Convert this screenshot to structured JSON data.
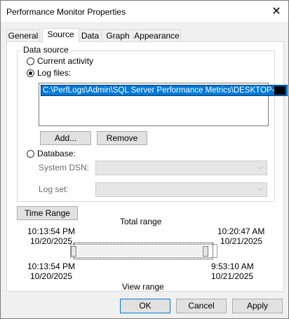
{
  "window": {
    "title": "Performance Monitor Properties",
    "close_glyph": "✕"
  },
  "tabs": [
    {
      "label": "General",
      "active": false
    },
    {
      "label": "Source",
      "active": true
    },
    {
      "label": "Data",
      "active": false
    },
    {
      "label": "Graph",
      "active": false
    },
    {
      "label": "Appearance",
      "active": false
    }
  ],
  "data_source": {
    "group_label": "Data source",
    "current_activity_label": "Current activity",
    "log_files_label": "Log files:",
    "selected_option": "Log files:",
    "log_files": [
      "C:\\PerfLogs\\Admin\\SQL Server Performance Metrics\\DESKTOP-"
    ],
    "add_button": "Add...",
    "remove_button": "Remove",
    "database_label": "Database:",
    "system_dsn_label": "System DSN:",
    "system_dsn_value": "",
    "log_set_label": "Log set:",
    "log_set_value": ""
  },
  "time_range": {
    "button_label": "Time Range",
    "total_range_label": "Total range",
    "total_start_time": "10:13:54 PM",
    "total_start_date": "10/20/2025",
    "total_end_time": "10:20:47 AM",
    "total_end_date": "10/21/2025",
    "view_start_time": "10:13:54 PM",
    "view_start_date": "10/20/2025",
    "view_end_time": "9:53:10 AM",
    "view_end_date": "10/21/2025",
    "view_range_label": "View range"
  },
  "footer": {
    "ok_label": "OK",
    "cancel_label": "Cancel",
    "apply_label": "Apply"
  }
}
